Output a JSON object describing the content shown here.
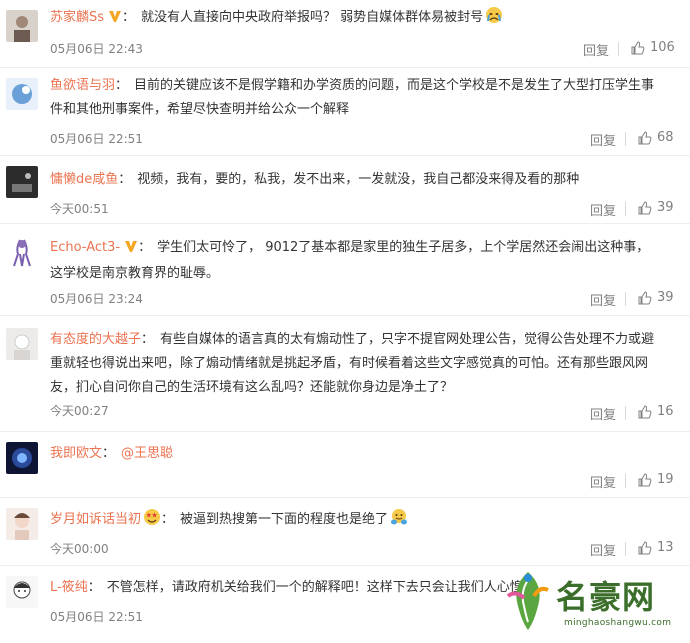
{
  "comments": [
    {
      "username": "苏家麟Ss",
      "verified": true,
      "emoji": "crying-face",
      "text": "就没有人直接向中央政府举报吗？ 弱势自媒体群体易被封号",
      "time": "05月06日 22:43",
      "reply_label": "回复",
      "likes": "106",
      "avatar_color": "#d9d2cb"
    },
    {
      "username": "鱼欲语与羽",
      "verified": false,
      "text": "目前的关键应该不是假学籍和办学资质的问题，而是这个学校是不是发生了大型打压学生事件和其他刑事案件，希望尽快查明并给公众一个解释",
      "time": "05月06日 22:51",
      "reply_label": "回复",
      "likes": "68",
      "avatar_color": "#6aa0d8"
    },
    {
      "username": "慵懒de咸鱼",
      "verified": false,
      "text": "视频，我有，要的，私我，发不出来，一发就没，我自己都没来得及看的那种",
      "time": "今天00:51",
      "reply_label": "回复",
      "likes": "39",
      "avatar_color": "#3a3a3a"
    },
    {
      "username": "Echo-Act3-",
      "verified": true,
      "text": "学生们太可怜了， 9012了基本都是家里的独生子居多，上个学居然还会闹出这种事，这学校是南京教育界的耻辱。",
      "time": "05月06日 23:24",
      "reply_label": "回复",
      "likes": "39",
      "avatar_color": "#8a6fb8"
    },
    {
      "username": "有态度的大越子",
      "verified": false,
      "text": "有些自媒体的语言真的太有煽动性了，只字不提官网处理公告，觉得公告处理不力或避重就轻也得说出来吧，除了煽动情绪就是挑起矛盾，有时候看着这些文字感觉真的可怕。还有那些跟风网友，扪心自问你自己的生活环境有这么乱吗？还能就你身边是净土了？",
      "time": "今天00:27",
      "reply_label": "回复",
      "likes": "16",
      "avatar_color": "#e8e6e4"
    },
    {
      "username": "我即欧文",
      "verified": false,
      "text": "@王思聪",
      "time": "",
      "reply_label": "回复",
      "likes": "19",
      "avatar_color": "#1a2a5a"
    },
    {
      "username": "岁月如诉话当初",
      "verified": false,
      "name_emoji": "star-eyes-face",
      "emoji": "hugging-face",
      "text": "被逼到热搜第一下面的程度也是绝了",
      "time": "今天00:00",
      "reply_label": "回复",
      "likes": "13",
      "avatar_color": "#efe3dc"
    },
    {
      "username": "L-筱纯",
      "verified": false,
      "text": "不管怎样，请政府机关给我们一个的解释吧！这样下去只会让我们人心惶",
      "time": "05月06日 22:51",
      "reply_label": "回复",
      "likes": "",
      "avatar_color": "#f0f0f0"
    }
  ],
  "watermark": {
    "title": "名豪网",
    "url": "minghaoshangwu.com"
  },
  "colors": {
    "username": "#eb7350",
    "meta": "#808080",
    "text": "#333333",
    "verified": "#f5a623"
  }
}
